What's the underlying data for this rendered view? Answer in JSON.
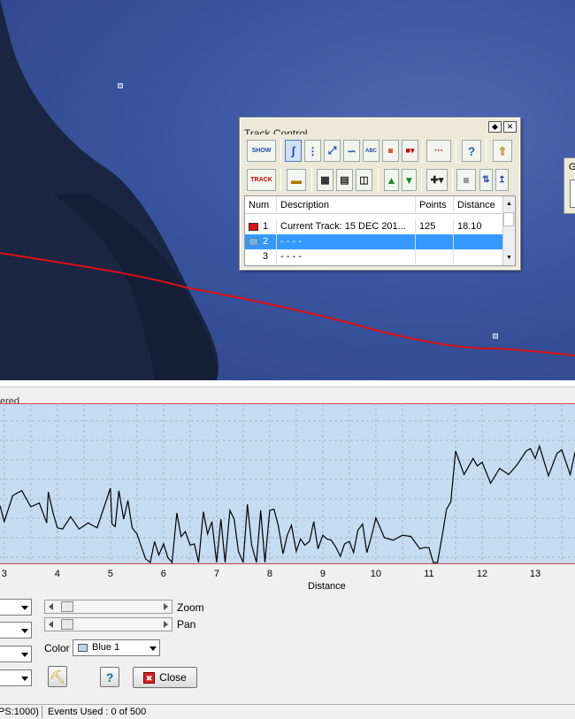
{
  "track_control": {
    "title": "Track Control",
    "row1_buttons": [
      {
        "name": "show-button",
        "label": "SHOW"
      },
      {
        "name": "draw-line-button",
        "label": ""
      },
      {
        "name": "vertical-tool-button",
        "label": ""
      },
      {
        "name": "diagonal-tool-button",
        "label": ""
      },
      {
        "name": "curve-tool-button",
        "label": ""
      },
      {
        "name": "abc-text-button",
        "label": "ABC"
      },
      {
        "name": "point-tool-button",
        "label": ""
      },
      {
        "name": "point-dropdown-button",
        "label": ""
      },
      {
        "name": "split-track-button",
        "label": ""
      },
      {
        "name": "help-button",
        "label": "?"
      },
      {
        "name": "save-up-button",
        "label": ""
      }
    ],
    "row2_buttons": [
      {
        "name": "track-button",
        "label": "TRACK"
      },
      {
        "name": "waypoint-button",
        "label": ""
      },
      {
        "name": "save-disk-button",
        "label": ""
      },
      {
        "name": "copy-button",
        "label": ""
      },
      {
        "name": "export-button",
        "label": ""
      },
      {
        "name": "move-up-button",
        "label": ""
      },
      {
        "name": "move-down-button",
        "label": ""
      },
      {
        "name": "add-dropdown-button",
        "label": ""
      },
      {
        "name": "tree-button",
        "label": ""
      },
      {
        "name": "sort-button",
        "label": ""
      },
      {
        "name": "upload-button",
        "label": ""
      }
    ],
    "columns": [
      "Num",
      "Description",
      "Points",
      "Distance"
    ],
    "rows": [
      {
        "num": "1",
        "description": "Current Track: 15 DEC 201...",
        "points": "125",
        "distance": "18.10",
        "color": "#e01010"
      },
      {
        "num": "2",
        "description": "- - - -",
        "points": "",
        "distance": "",
        "color": "#7ab0d8"
      },
      {
        "num": "3",
        "description": "- - - -",
        "points": "",
        "distance": "",
        "color": ""
      }
    ]
  },
  "profile": {
    "header_fragment": "ered",
    "x_label": "Distance",
    "zoom_label": "Zoom",
    "pan_label": "Pan",
    "color_label": "Color",
    "color_value": "Blue 1",
    "close_label": "Close",
    "help_label": "?"
  },
  "status": {
    "left": "PS:1000)",
    "events": "Events Used : 0 of 500"
  },
  "chart_data": {
    "type": "line",
    "xlabel": "Distance",
    "ylabel": "",
    "xlim": [
      2.92,
      13.75
    ],
    "x_ticks": [
      3,
      4,
      5,
      6,
      7,
      8,
      9,
      10,
      11,
      12,
      13
    ],
    "series": [
      {
        "color": "#000000",
        "x": [
          2.92,
          3.0,
          3.16,
          3.33,
          3.5,
          3.66,
          3.8,
          3.83,
          3.92,
          4.0,
          4.1,
          4.25,
          4.41,
          4.58,
          4.66,
          4.75,
          5.0,
          5.03,
          5.09,
          5.16,
          5.25,
          5.33,
          5.41,
          5.5,
          5.66,
          5.75,
          5.83,
          5.91,
          6.0,
          6.08,
          6.16,
          6.25,
          6.33,
          6.41,
          6.5,
          6.58,
          6.66,
          6.75,
          6.83,
          6.91,
          7.0,
          7.08,
          7.16,
          7.25,
          7.33,
          7.41,
          7.5,
          7.58,
          7.66,
          7.75,
          7.83,
          7.91,
          8.0,
          8.08,
          8.16,
          8.25,
          8.33,
          8.41,
          8.5,
          8.58,
          8.66,
          8.75,
          8.83,
          8.91,
          9.0,
          9.08,
          9.16,
          9.25,
          9.33,
          9.41,
          9.5,
          9.58,
          9.66,
          9.75,
          9.83,
          9.91,
          10.0,
          10.16,
          10.33,
          10.5,
          10.66,
          10.83,
          10.91,
          11.0,
          11.08,
          11.16,
          11.25,
          11.33,
          11.41,
          11.5,
          11.66,
          11.83,
          11.91,
          12.0,
          12.16,
          12.33,
          12.5,
          12.66,
          12.83,
          12.91,
          13.0,
          13.08,
          13.25,
          13.41,
          13.5,
          13.66,
          13.75
        ],
        "y": [
          46,
          33,
          54,
          58,
          45,
          48,
          32,
          57,
          40,
          28,
          27,
          37,
          27,
          32,
          30,
          28,
          60,
          31,
          29,
          58,
          35,
          50,
          28,
          23,
          3,
          0,
          17,
          6,
          15,
          4,
          0,
          40,
          21,
          25,
          14,
          15,
          0,
          41,
          23,
          33,
          0,
          35,
          0,
          42,
          35,
          9,
          0,
          47,
          14,
          0,
          42,
          0,
          42,
          43,
          30,
          7,
          22,
          30,
          9,
          19,
          14,
          17,
          33,
          11,
          22,
          19,
          18,
          12,
          5,
          15,
          17,
          8,
          26,
          31,
          8,
          20,
          36,
          20,
          18,
          22,
          21,
          11,
          12,
          12,
          0,
          0,
          22,
          43,
          49,
          90,
          71,
          84,
          78,
          81,
          64,
          76,
          71,
          79,
          90,
          92,
          84,
          94,
          70,
          88,
          91,
          71,
          89
        ]
      }
    ]
  }
}
